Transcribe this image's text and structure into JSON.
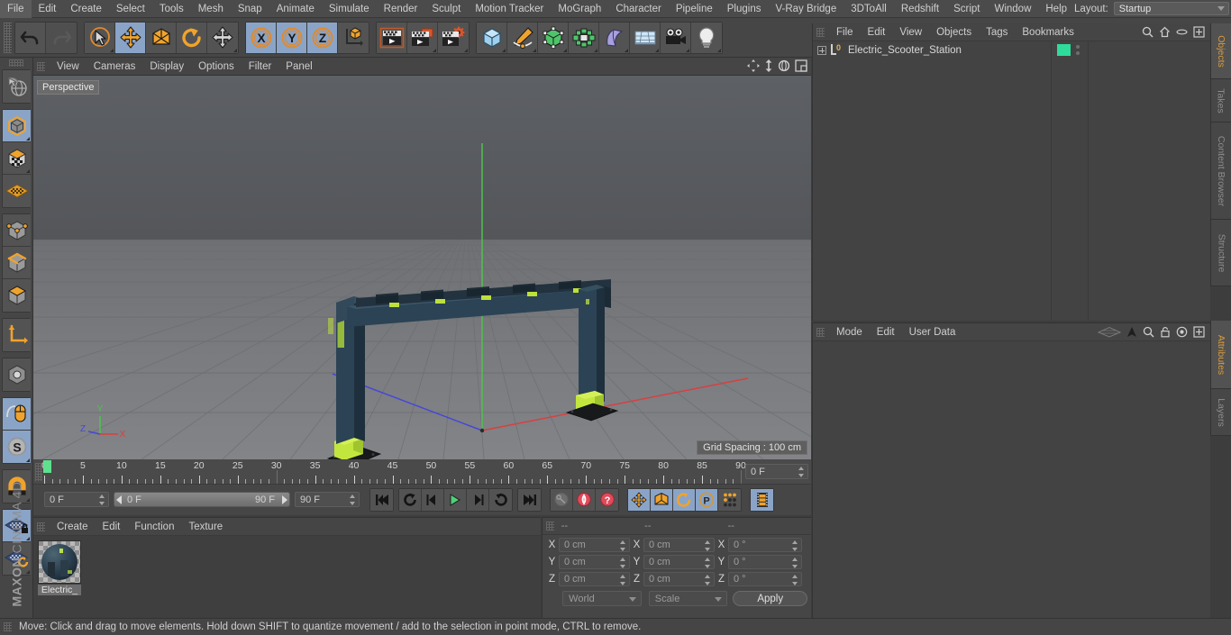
{
  "app": {
    "name": "MAXON",
    "product": "CINEMA 4D"
  },
  "menubar": {
    "items": [
      "File",
      "Edit",
      "Create",
      "Select",
      "Tools",
      "Mesh",
      "Snap",
      "Animate",
      "Simulate",
      "Render",
      "Sculpt",
      "Motion Tracker",
      "MoGraph",
      "Character",
      "Pipeline",
      "Plugins",
      "V-Ray Bridge",
      "3DToAll",
      "Redshift",
      "Script",
      "Window",
      "Help"
    ],
    "layout_label": "Layout:",
    "layout_value": "Startup"
  },
  "toolbar": {
    "groups": [
      {
        "name": "undo-redo",
        "buttons": [
          {
            "icon": "undo-icon",
            "label": "Undo",
            "state": "normal"
          },
          {
            "icon": "redo-icon",
            "label": "Redo",
            "state": "disabled"
          }
        ]
      },
      {
        "name": "transform-tools",
        "buttons": [
          {
            "icon": "select-cursor-icon",
            "label": "Live Selection",
            "state": "normal"
          },
          {
            "icon": "move-icon",
            "label": "Move",
            "state": "selected"
          },
          {
            "icon": "scale-icon",
            "label": "Scale",
            "state": "normal"
          },
          {
            "icon": "rotate-icon",
            "label": "Rotate",
            "state": "normal"
          },
          {
            "icon": "move-alt-icon",
            "label": "Move Alt",
            "state": "normal"
          }
        ]
      },
      {
        "name": "axis-locks",
        "buttons": [
          {
            "icon": "x-axis-icon",
            "label": "X",
            "state": "selected"
          },
          {
            "icon": "y-axis-icon",
            "label": "Y",
            "state": "selected"
          },
          {
            "icon": "z-axis-icon",
            "label": "Z",
            "state": "selected"
          },
          {
            "icon": "world-object-axis-icon",
            "label": "World/Object",
            "state": "normal"
          }
        ]
      },
      {
        "name": "render-tools",
        "buttons": [
          {
            "icon": "render-view-icon",
            "label": "Render View",
            "state": "normal"
          },
          {
            "icon": "render-picture-viewer-icon",
            "label": "Render to Picture Viewer",
            "state": "normal"
          },
          {
            "icon": "render-settings-icon",
            "label": "Edit Render Settings",
            "state": "normal"
          }
        ]
      },
      {
        "name": "create-objects",
        "buttons": [
          {
            "icon": "cube-primitive-icon",
            "label": "Cube",
            "state": "normal"
          },
          {
            "icon": "pen-spline-icon",
            "label": "Spline Pen",
            "state": "normal"
          },
          {
            "icon": "nurbs-icon",
            "label": "Subdivision Surface",
            "state": "normal"
          },
          {
            "icon": "array-icon",
            "label": "Array",
            "state": "normal"
          },
          {
            "icon": "deformer-bend-icon",
            "label": "Bend",
            "state": "normal"
          },
          {
            "icon": "floor-environment-icon",
            "label": "Floor",
            "state": "normal"
          },
          {
            "icon": "camera-icon",
            "label": "Camera",
            "state": "normal"
          },
          {
            "icon": "light-icon",
            "label": "Light",
            "state": "normal"
          }
        ]
      }
    ]
  },
  "left_toolbar": {
    "groups": [
      {
        "name": "selection",
        "buttons": [
          {
            "icon": "globe-select-icon",
            "label": "Selection Filter",
            "state": "normal"
          }
        ]
      },
      {
        "name": "mode-modeling",
        "buttons": [
          {
            "icon": "model-mode-icon",
            "label": "Model Mode",
            "state": "selected"
          },
          {
            "icon": "texture-mode-icon",
            "label": "Texture Mode",
            "state": "normal"
          },
          {
            "icon": "workplane-icon",
            "label": "Workplane",
            "state": "normal"
          }
        ]
      },
      {
        "name": "component-modes",
        "buttons": [
          {
            "icon": "point-mode-icon",
            "label": "Points",
            "state": "normal"
          },
          {
            "icon": "edge-mode-icon",
            "label": "Edges",
            "state": "normal"
          },
          {
            "icon": "polygon-mode-icon",
            "label": "Polygons",
            "state": "normal"
          }
        ]
      },
      {
        "name": "axis-mode",
        "buttons": [
          {
            "icon": "object-axis-icon",
            "label": "Enable Axis Modification",
            "state": "normal"
          }
        ]
      },
      {
        "name": "viewport-mode",
        "buttons": [
          {
            "icon": "viewport-solo-icon",
            "label": "Viewport Solo",
            "state": "normal"
          }
        ]
      },
      {
        "name": "tweak-mode",
        "buttons": [
          {
            "icon": "tweak-mouse-icon",
            "label": "Tweak Mode",
            "state": "selected"
          },
          {
            "icon": "soft-selection-icon",
            "label": "Soft Selection",
            "state": "selected"
          }
        ]
      },
      {
        "name": "snap",
        "buttons": [
          {
            "icon": "magnet-snap-icon",
            "label": "Enable Snapping",
            "state": "normal"
          }
        ]
      },
      {
        "name": "workplane-lock",
        "buttons": [
          {
            "icon": "workplane-lock-icon",
            "label": "Lock Workplane",
            "state": "selected"
          },
          {
            "icon": "workplane-align-icon",
            "label": "Planar Workplane",
            "state": "normal"
          }
        ]
      }
    ]
  },
  "viewport": {
    "menu": [
      "View",
      "Cameras",
      "Display",
      "Options",
      "Filter",
      "Panel"
    ],
    "label": "Perspective",
    "grid_spacing": "Grid Spacing : 100 cm",
    "axis_gizmo": {
      "x": "X",
      "y": "Y",
      "z": "Z"
    },
    "icons": [
      "pan-view-icon",
      "dolly-view-icon",
      "rotate-view-icon",
      "maximize-view-icon"
    ],
    "colors": {
      "axis_x": "#d84040",
      "axis_y": "#4fc14f",
      "axis_z": "#4646d8",
      "model_body": "#2e4654",
      "model_accent": "#bde03a",
      "model_base": "#1d1d1d"
    }
  },
  "timeline": {
    "ticks": [
      "0",
      "5",
      "10",
      "15",
      "20",
      "25",
      "30",
      "35",
      "40",
      "45",
      "50",
      "55",
      "60",
      "65",
      "70",
      "75",
      "80",
      "85",
      "90"
    ],
    "current_frame_ruler": "0 F",
    "current_frame": "0 F",
    "range_start": "0 F",
    "range_end": "90 F",
    "max_frame": "90 F",
    "playhead_color": "#5fe08f",
    "transport": [
      {
        "icon": "go-to-start-icon",
        "label": "Go to Start"
      },
      {
        "icon": "loop-icon",
        "label": "Play Mode Loop"
      },
      {
        "icon": "step-back-icon",
        "label": "Go to Previous Frame"
      },
      {
        "icon": "play-icon",
        "label": "Play Forwards"
      },
      {
        "icon": "step-forward-icon",
        "label": "Go to Next Frame"
      },
      {
        "icon": "play-reverse-icon",
        "label": "Play Backwards"
      },
      {
        "icon": "go-to-end-icon",
        "label": "Go to End"
      }
    ],
    "keyframe_tools": [
      {
        "icon": "record-key-icon",
        "label": "Record Active Objects",
        "state": "disabled"
      },
      {
        "icon": "autokey-icon",
        "label": "Autokeying",
        "state": "normal"
      },
      {
        "icon": "keyframe-selection-icon",
        "label": "Keyframe Selection",
        "state": "normal"
      }
    ],
    "key_channels": [
      {
        "icon": "position-key-icon",
        "label": "Position",
        "state": "selected"
      },
      {
        "icon": "scale-key-icon",
        "label": "Scale",
        "state": "selected"
      },
      {
        "icon": "rotation-key-icon",
        "label": "Rotation",
        "state": "selected"
      },
      {
        "icon": "parameter-key-icon",
        "label": "Parameter",
        "state": "selected"
      },
      {
        "icon": "pla-key-icon",
        "label": "Point Level Animation",
        "state": "normal"
      }
    ],
    "extra": [
      {
        "icon": "timeline-filmstrip-icon",
        "label": "Timeline",
        "state": "selected"
      }
    ]
  },
  "material_manager": {
    "menu": [
      "Create",
      "Edit",
      "Function",
      "Texture"
    ],
    "materials": [
      {
        "name": "Electric_",
        "preview": "electric-scooter-station-material"
      }
    ]
  },
  "coordinates": {
    "headers": [
      "--",
      "--",
      "--"
    ],
    "rows": [
      {
        "axis": "X",
        "position": "0 cm",
        "size": "0 cm",
        "rotation": "0 °"
      },
      {
        "axis": "Y",
        "position": "0 cm",
        "size": "0 cm",
        "rotation": "0 °"
      },
      {
        "axis": "Z",
        "position": "0 cm",
        "size": "0 cm",
        "rotation": "0 °"
      }
    ],
    "system": "World",
    "mode": "Scale",
    "apply_label": "Apply"
  },
  "object_manager": {
    "menu": [
      "File",
      "Edit",
      "View",
      "Objects",
      "Tags",
      "Bookmarks"
    ],
    "icons": [
      "search-icon",
      "home-icon",
      "filter-icon",
      "maximize-icon"
    ],
    "objects": [
      {
        "name": "Electric_Scooter_Station",
        "level": 0,
        "expandable": true,
        "layer_color": "#2fdb9a"
      }
    ]
  },
  "attribute_manager": {
    "menu": [
      "Mode",
      "Edit",
      "User Data"
    ],
    "icons": [
      "plane-preview-icon",
      "arrow-cursor-icon",
      "search-icon",
      "lock-icon",
      "target-icon",
      "maximize-icon"
    ]
  },
  "vertical_tabs_top": [
    {
      "label": "Objects",
      "active": true
    },
    {
      "label": "Takes",
      "active": false
    },
    {
      "label": "Content Browser",
      "active": false
    },
    {
      "label": "Structure",
      "active": false
    }
  ],
  "vertical_tabs_bottom": [
    {
      "label": "Attributes",
      "active": true
    },
    {
      "label": "Layers",
      "active": false
    }
  ],
  "status_bar": {
    "message": "Move: Click and drag to move elements. Hold down SHIFT to quantize movement / add to the selection in point mode, CTRL to remove."
  }
}
